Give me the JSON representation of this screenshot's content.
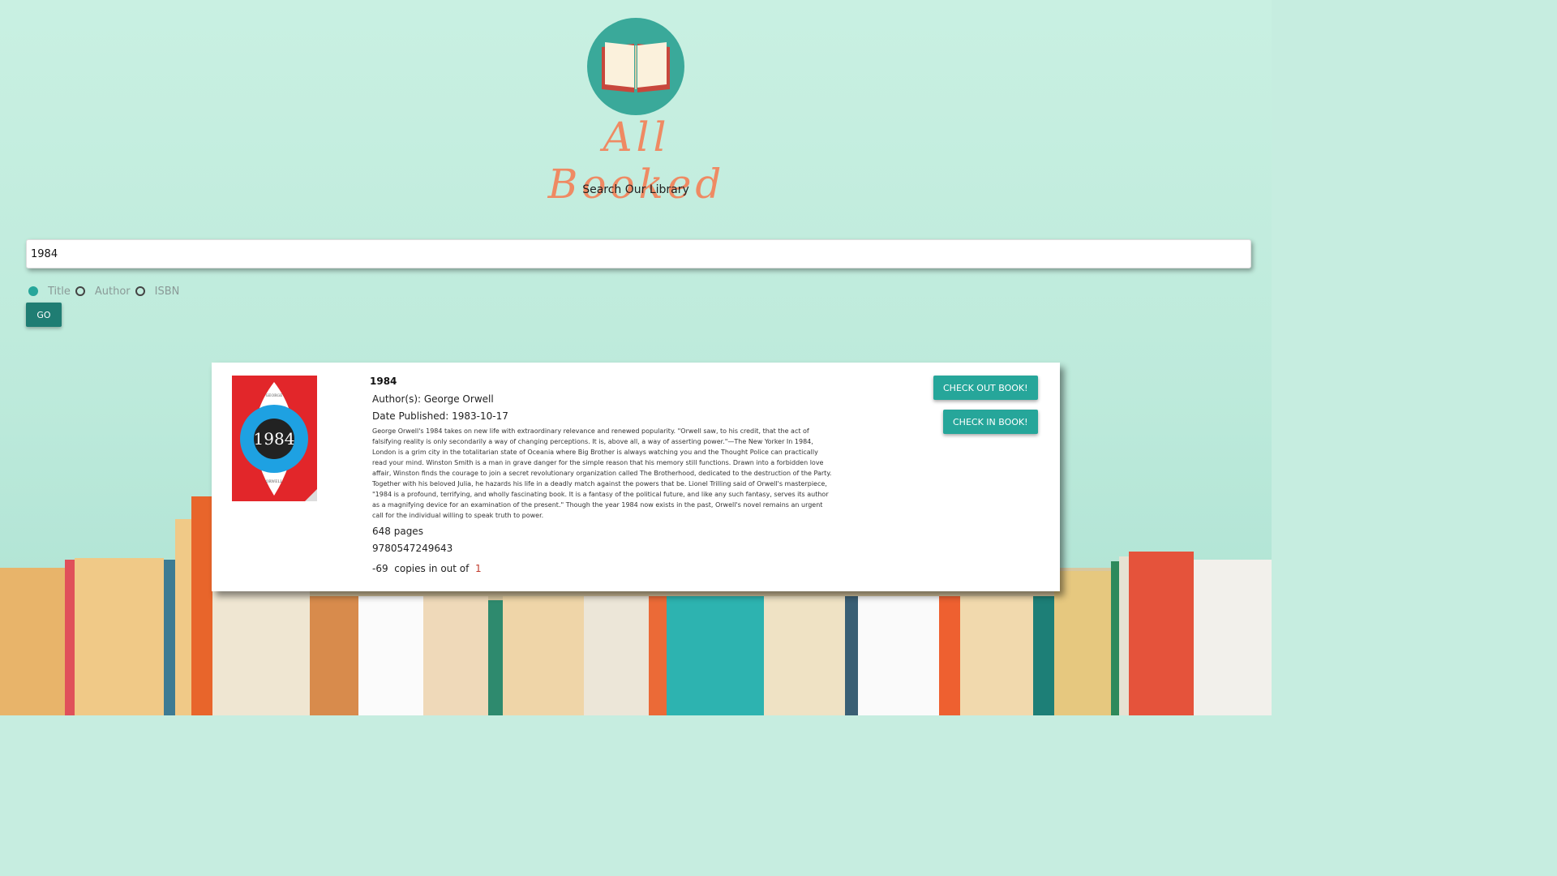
{
  "app": {
    "logo_text": "All Booked",
    "subtitle": "Search Our Library"
  },
  "search": {
    "value": "1984"
  },
  "filters": {
    "options": [
      "Title",
      "Author",
      "ISBN"
    ],
    "selected": "Title"
  },
  "go_label": "GO",
  "result": {
    "title": "1984",
    "authors_label": "Author(s): George Orwell",
    "date_label": "Date Published: 1983-10-17",
    "description": "George Orwell's 1984 takes on new life with extraordinary relevance and renewed popularity. \"Orwell saw, to his credit, that the act of falsifying reality is only secondarily a way of changing perceptions. It is, above all, a way of asserting power.\"—The New Yorker In 1984, London is a grim city in the totalitarian state of Oceania where Big Brother is always watching you and the Thought Police can practically read your mind. Winston Smith is a man in grave danger for the simple reason that his memory still functions. Drawn into a forbidden love affair, Winston finds the courage to join a secret revolutionary organization called The Brotherhood, dedicated to the destruction of the Party. Together with his beloved Julia, he hazards his life in a deadly match against the powers that be. Lionel Trilling said of Orwell's masterpiece, \"1984 is a profound, terrifying, and wholly fascinating book. It is a fantasy of the political future, and like any such fantasy, serves its author as a magnifying device for an examination of the present.\" Though the year 1984 now exists in the past, Orwell's novel remains an urgent call for the individual willing to speak truth to power.",
    "pages": "648 pages",
    "isbn": "9780547249643",
    "copies_in": "-69",
    "copies_mid": "copies in out of",
    "copies_total": "1",
    "cover": {
      "author_top": "GEORGE",
      "title": "1984",
      "author_bottom": "ORWELL"
    }
  },
  "buttons": {
    "check_out": "CHECK OUT BOOK!",
    "check_in": "CHECK IN BOOK!"
  },
  "colors": {
    "accent": "#26a69a",
    "go": "#1f7d73",
    "logo": "#ef8a63",
    "cover_red": "#e2262a",
    "cover_blue": "#1ea1e2"
  }
}
